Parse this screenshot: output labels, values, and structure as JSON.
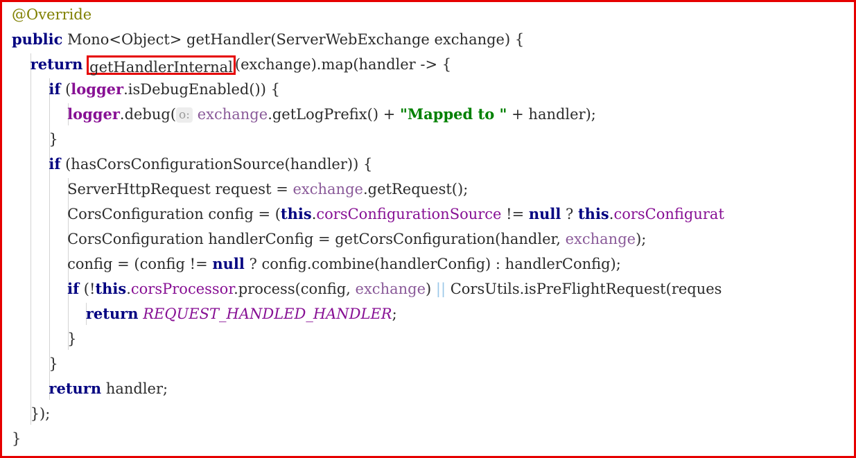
{
  "panel": {
    "title": "Java source snippet",
    "border_color": "#e60000",
    "background_color": "#ffffff",
    "highlight_box_color": "#e60000",
    "highlighted_symbol": "getHandlerInternal"
  },
  "theme": {
    "default_text": "#2b2b2b",
    "keyword": "#000080",
    "annotation": "#808000",
    "string": "#008000",
    "field": "#871094",
    "static_field": "#871094",
    "constant": "#871094",
    "parameter": "#8a5a99",
    "indent_guide": "#d3d3d3",
    "inlay_hint_bg": "#ededed",
    "inlay_hint_fg": "#9a9a9a"
  },
  "inlay_hints": [
    {
      "label": "o:",
      "line": 4
    }
  ],
  "code": {
    "language": "java",
    "lines": [
      {
        "id": "line-1",
        "indent": 0,
        "text": "@Override",
        "tokens": [
          {
            "t": "@Override",
            "c": "annot"
          }
        ]
      },
      {
        "id": "line-2",
        "indent": 0,
        "text": "public Mono<Object> getHandler(ServerWebExchange exchange) {",
        "tokens": [
          {
            "t": "public",
            "c": "keyword"
          },
          {
            "t": " Mono<Object> getHandler(ServerWebExchange exchange) {",
            "c": "default"
          }
        ]
      },
      {
        "id": "line-3",
        "indent": 1,
        "text": "    return getHandlerInternal(exchange).map(handler -> {",
        "tokens": [
          {
            "t": "    ",
            "c": "default"
          },
          {
            "t": "return",
            "c": "keyword"
          },
          {
            "t": " ",
            "c": "default"
          },
          {
            "t": "getHandlerInternal",
            "c": "default",
            "box": true
          },
          {
            "t": "(exchange).map(handler -> {",
            "c": "default"
          }
        ]
      },
      {
        "id": "line-4",
        "indent": 2,
        "text": "        if (logger.isDebugEnabled()) {",
        "tokens": [
          {
            "t": "        ",
            "c": "default"
          },
          {
            "t": "if",
            "c": "keyword"
          },
          {
            "t": " (",
            "c": "default"
          },
          {
            "t": "logger",
            "c": "staticfld"
          },
          {
            "t": ".isDebugEnabled()) {",
            "c": "default"
          }
        ]
      },
      {
        "id": "line-5",
        "indent": 3,
        "text": "            logger.debug( o: exchange.getLogPrefix() + \"Mapped to \" + handler);",
        "tokens": [
          {
            "t": "            ",
            "c": "default"
          },
          {
            "t": "logger",
            "c": "staticfld"
          },
          {
            "t": ".debug(",
            "c": "default"
          },
          {
            "t": "o:",
            "c": "inlay"
          },
          {
            "t": " ",
            "c": "default"
          },
          {
            "t": "exchange",
            "c": "param"
          },
          {
            "t": ".getLogPrefix() + ",
            "c": "default"
          },
          {
            "t": "\"Mapped to \"",
            "c": "string"
          },
          {
            "t": " + handler);",
            "c": "default"
          }
        ]
      },
      {
        "id": "line-6",
        "indent": 2,
        "text": "        }",
        "tokens": [
          {
            "t": "        }",
            "c": "default"
          }
        ]
      },
      {
        "id": "line-7",
        "indent": 2,
        "text": "        if (hasCorsConfigurationSource(handler)) {",
        "tokens": [
          {
            "t": "        ",
            "c": "default"
          },
          {
            "t": "if",
            "c": "keyword"
          },
          {
            "t": " (hasCorsConfigurationSource(handler)) {",
            "c": "default"
          }
        ]
      },
      {
        "id": "line-8",
        "indent": 3,
        "text": "            ServerHttpRequest request = exchange.getRequest();",
        "tokens": [
          {
            "t": "            ServerHttpRequest request = ",
            "c": "default"
          },
          {
            "t": "exchange",
            "c": "param"
          },
          {
            "t": ".getRequest();",
            "c": "default"
          }
        ]
      },
      {
        "id": "line-9",
        "indent": 3,
        "text": "            CorsConfiguration config = (this.corsConfigurationSource != null ? this.corsConfigurat",
        "tokens": [
          {
            "t": "            CorsConfiguration config = (",
            "c": "default"
          },
          {
            "t": "this",
            "c": "keyword"
          },
          {
            "t": ".",
            "c": "default"
          },
          {
            "t": "corsConfigurationSource",
            "c": "field"
          },
          {
            "t": " != ",
            "c": "default"
          },
          {
            "t": "null",
            "c": "keyword"
          },
          {
            "t": " ? ",
            "c": "default"
          },
          {
            "t": "this",
            "c": "keyword"
          },
          {
            "t": ".",
            "c": "default"
          },
          {
            "t": "corsConfigurat",
            "c": "field"
          }
        ]
      },
      {
        "id": "line-10",
        "indent": 3,
        "text": "            CorsConfiguration handlerConfig = getCorsConfiguration(handler, exchange);",
        "tokens": [
          {
            "t": "            CorsConfiguration handlerConfig = getCorsConfiguration(handler, ",
            "c": "default"
          },
          {
            "t": "exchange",
            "c": "param"
          },
          {
            "t": ");",
            "c": "default"
          }
        ]
      },
      {
        "id": "line-11",
        "indent": 3,
        "text": "            config = (config != null ? config.combine(handlerConfig) : handlerConfig);",
        "tokens": [
          {
            "t": "            config = (config != ",
            "c": "default"
          },
          {
            "t": "null",
            "c": "keyword"
          },
          {
            "t": " ? config.combine(handlerConfig) : handlerConfig);",
            "c": "default"
          }
        ]
      },
      {
        "id": "line-12",
        "indent": 3,
        "text": "            if (!this.corsProcessor.process(config, exchange) || CorsUtils.isPreFlightRequest(reques",
        "tokens": [
          {
            "t": "            ",
            "c": "default"
          },
          {
            "t": "if",
            "c": "keyword"
          },
          {
            "t": " (!",
            "c": "default"
          },
          {
            "t": "this",
            "c": "keyword"
          },
          {
            "t": ".",
            "c": "default"
          },
          {
            "t": "corsProcessor",
            "c": "field"
          },
          {
            "t": ".process(config, ",
            "c": "default"
          },
          {
            "t": "exchange",
            "c": "param"
          },
          {
            "t": ") ",
            "c": "default"
          },
          {
            "t": "||",
            "c": "orop"
          },
          {
            "t": " CorsUtils.isPreFlightRequest(reques",
            "c": "default"
          }
        ]
      },
      {
        "id": "line-13",
        "indent": 4,
        "text": "                return REQUEST_HANDLED_HANDLER;",
        "tokens": [
          {
            "t": "                ",
            "c": "default"
          },
          {
            "t": "return",
            "c": "keyword"
          },
          {
            "t": " ",
            "c": "default"
          },
          {
            "t": "REQUEST_HANDLED_HANDLER",
            "c": "constant"
          },
          {
            "t": ";",
            "c": "default"
          }
        ]
      },
      {
        "id": "line-14",
        "indent": 3,
        "text": "            }",
        "tokens": [
          {
            "t": "            }",
            "c": "default"
          }
        ]
      },
      {
        "id": "line-15",
        "indent": 2,
        "text": "        }",
        "tokens": [
          {
            "t": "        }",
            "c": "default"
          }
        ]
      },
      {
        "id": "line-16",
        "indent": 2,
        "text": "        return handler;",
        "tokens": [
          {
            "t": "        ",
            "c": "default"
          },
          {
            "t": "return",
            "c": "keyword"
          },
          {
            "t": " handler;",
            "c": "default"
          }
        ]
      },
      {
        "id": "line-17",
        "indent": 1,
        "text": "    });",
        "tokens": [
          {
            "t": "    });",
            "c": "default"
          }
        ]
      },
      {
        "id": "line-18",
        "indent": 0,
        "text": "}",
        "tokens": [
          {
            "t": "}",
            "c": "default"
          }
        ]
      }
    ]
  }
}
